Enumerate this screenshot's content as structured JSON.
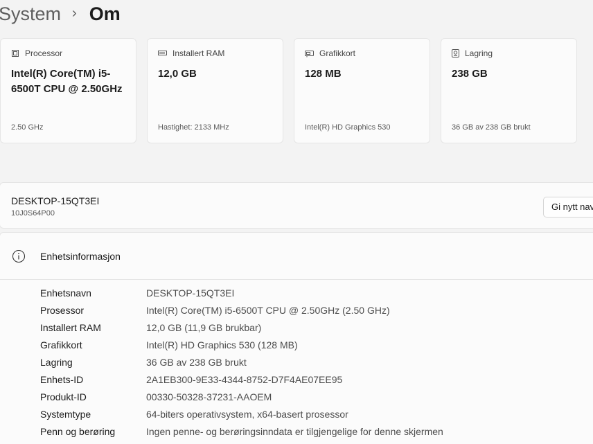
{
  "breadcrumb": {
    "parent": "System",
    "separator": "›",
    "current": "Om"
  },
  "cards": [
    {
      "icon": "processor-icon",
      "title": "Processor",
      "value": "Intel(R) Core(TM) i5-6500T CPU @ 2.50GHz",
      "sub": "2.50 GHz"
    },
    {
      "icon": "ram-icon",
      "title": "Installert RAM",
      "value": "12,0 GB",
      "sub": "Hastighet: 2133 MHz"
    },
    {
      "icon": "graphics-card-icon",
      "title": "Grafikkort",
      "value": "128 MB",
      "sub": "Intel(R) HD Graphics 530"
    },
    {
      "icon": "storage-icon",
      "title": "Lagring",
      "value": "238 GB",
      "sub": "36 GB av 238 GB brukt"
    }
  ],
  "device": {
    "name": "DESKTOP-15QT3EI",
    "model": "10J0S64P00",
    "rename_label": "Gi nytt navn til denne PC-en"
  },
  "device_info": {
    "icon": "info-icon",
    "title": "Enhetsinformasjon",
    "rows": [
      {
        "label": "Enhetsnavn",
        "value": "DESKTOP-15QT3EI"
      },
      {
        "label": "Prosessor",
        "value": "Intel(R) Core(TM) i5-6500T CPU @ 2.50GHz (2.50 GHz)"
      },
      {
        "label": "Installert RAM",
        "value": "12,0 GB (11,9 GB brukbar)"
      },
      {
        "label": "Grafikkort",
        "value": "Intel(R) HD Graphics 530 (128 MB)"
      },
      {
        "label": "Lagring",
        "value": "36 GB av 238 GB brukt"
      },
      {
        "label": "Enhets-ID",
        "value": "2A1EB300-9E33-4344-8752-D7F4AE07EE95"
      },
      {
        "label": "Produkt-ID",
        "value": "00330-50328-37231-AAOEM"
      },
      {
        "label": "Systemtype",
        "value": "64-biters operativsystem, x64-basert prosessor"
      },
      {
        "label": "Penn og berøring",
        "value": "Ingen penne- og berøringsinndata er tilgjengelige for denne skjermen"
      }
    ]
  }
}
